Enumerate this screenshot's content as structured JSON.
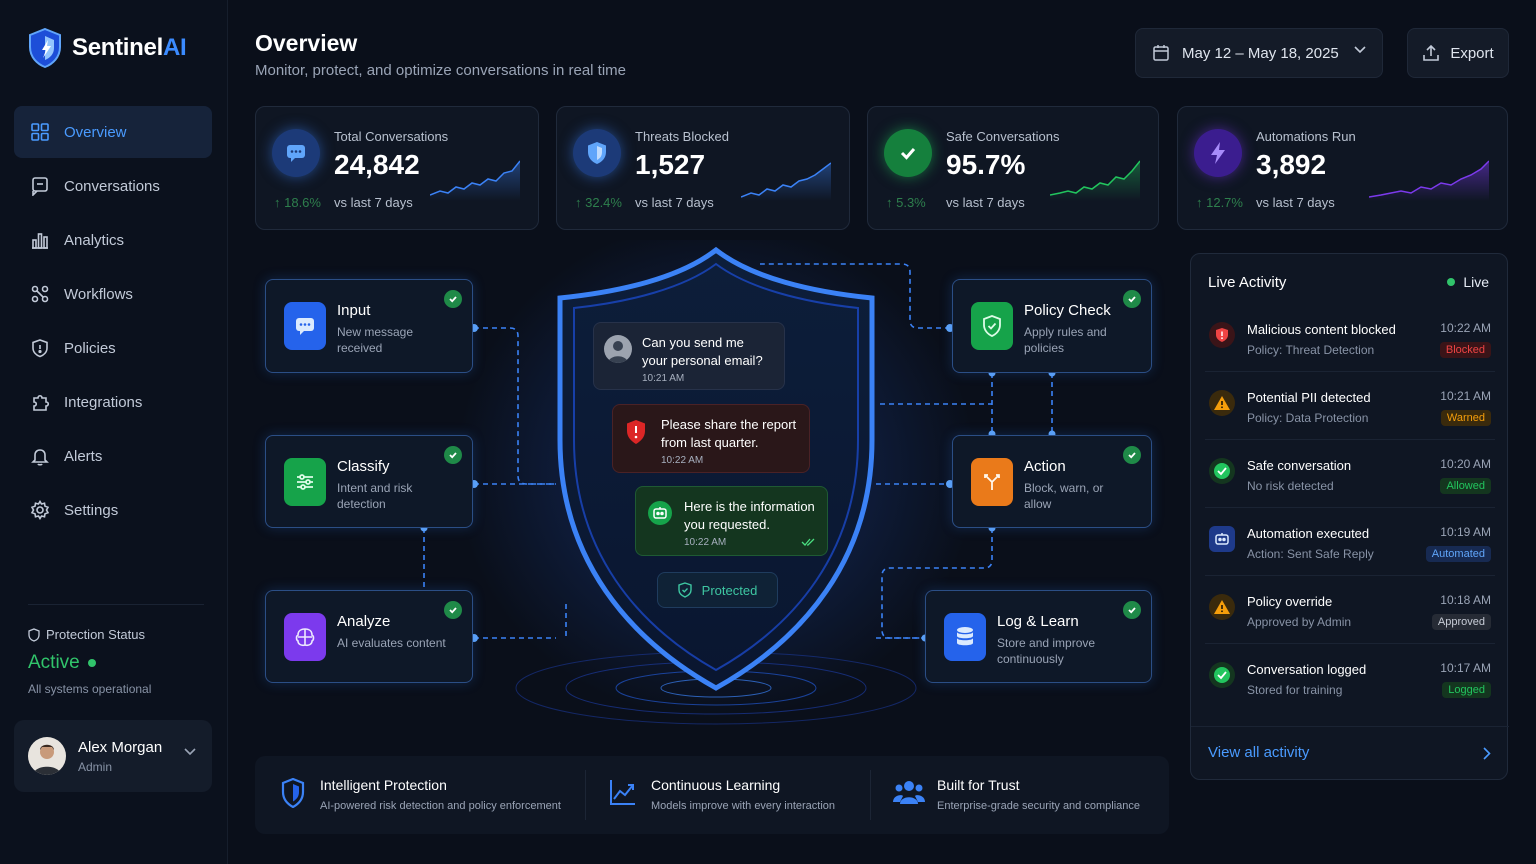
{
  "brand": {
    "name_main": "Sentinel",
    "name_accent": "AI"
  },
  "sidebar": {
    "items": [
      {
        "label": "Overview",
        "icon": "grid-icon",
        "active": true
      },
      {
        "label": "Conversations",
        "icon": "chat-icon"
      },
      {
        "label": "Analytics",
        "icon": "bar-chart-icon"
      },
      {
        "label": "Workflows",
        "icon": "workflow-icon"
      },
      {
        "label": "Policies",
        "icon": "shield-doc-icon"
      },
      {
        "label": "Integrations",
        "icon": "puzzle-icon"
      },
      {
        "label": "Alerts",
        "icon": "bell-icon"
      },
      {
        "label": "Settings",
        "icon": "gear-icon"
      }
    ],
    "protection": {
      "label": "Protection Status",
      "status": "Active",
      "sub": "All systems operational"
    },
    "user": {
      "name": "Alex Morgan",
      "role": "Admin"
    }
  },
  "header": {
    "title": "Overview",
    "subtitle": "Monitor, protect, and optimize conversations in real time",
    "date_range": "May 12 – May 18, 2025",
    "export_label": "Export"
  },
  "stats": [
    {
      "label": "Total Conversations",
      "value": "24,842",
      "delta": "↑ 18.6%",
      "vs": "vs last 7 days",
      "color": "#3b82f6",
      "icon": "chat-bubble-icon"
    },
    {
      "label": "Threats Blocked",
      "value": "1,527",
      "delta": "↑ 32.4%",
      "vs": "vs last 7 days",
      "color": "#3b82f6",
      "icon": "shield-icon"
    },
    {
      "label": "Safe Conversations",
      "value": "95.7%",
      "delta": "↑ 5.3%",
      "vs": "vs last 7 days",
      "color": "#22c55e",
      "icon": "check-icon"
    },
    {
      "label": "Automations Run",
      "value": "3,892",
      "delta": "↑ 12.7%",
      "vs": "vs last 7 days",
      "color": "#7c3aed",
      "icon": "bolt-icon"
    }
  ],
  "flow": {
    "nodes": [
      {
        "title": "Input",
        "desc": "New message received",
        "color": "#2563eb",
        "icon": "chat-bubble-icon"
      },
      {
        "title": "Classify",
        "desc": "Intent and risk detection",
        "color": "#16a34a",
        "icon": "sliders-icon"
      },
      {
        "title": "Analyze",
        "desc": "AI evaluates content",
        "color": "#7c3aed",
        "icon": "brain-icon"
      },
      {
        "title": "Policy Check",
        "desc": "Apply rules and policies",
        "color": "#16a34a",
        "icon": "shield-check-icon"
      },
      {
        "title": "Action",
        "desc": "Block, warn, or allow",
        "color": "#ea7a1a",
        "icon": "branch-icon"
      },
      {
        "title": "Log & Learn",
        "desc": "Store and improve continuously",
        "color": "#2563eb",
        "icon": "database-icon"
      }
    ],
    "messages": [
      {
        "text_line1": "Can you send me",
        "text_line2": "your personal email?",
        "time": "10:21 AM"
      },
      {
        "text_line1": "Please share the report",
        "text_line2": "from last quarter.",
        "time": "10:22 AM"
      },
      {
        "text_line1": "Here is the information",
        "text_line2": "you requested.",
        "time": "10:22 AM"
      }
    ],
    "protected_label": "Protected"
  },
  "live": {
    "title": "Live Activity",
    "badge": "Live",
    "items": [
      {
        "title": "Malicious content blocked",
        "sub": "Policy: Threat Detection",
        "time": "10:22 AM",
        "tag": "Blocked",
        "tag_color": "#ef4444",
        "icon": "shield-alert-icon"
      },
      {
        "title": "Potential PII detected",
        "sub": "Policy: Data Protection",
        "time": "10:21 AM",
        "tag": "Warned",
        "tag_color": "#f59e0b",
        "icon": "warning-icon"
      },
      {
        "title": "Safe conversation",
        "sub": "No risk detected",
        "time": "10:20 AM",
        "tag": "Allowed",
        "tag_color": "#22c55e",
        "icon": "check-icon"
      },
      {
        "title": "Automation executed",
        "sub": "Action: Sent Safe Reply",
        "time": "10:19 AM",
        "tag": "Automated",
        "tag_color": "#3b82f6",
        "icon": "bot-icon"
      },
      {
        "title": "Policy override",
        "sub": "Approved by Admin",
        "time": "10:18 AM",
        "tag": "Approved",
        "tag_color": "#9ca3af",
        "icon": "warning-icon"
      },
      {
        "title": "Conversation logged",
        "sub": "Stored for training",
        "time": "10:17 AM",
        "tag": "Logged",
        "tag_color": "#22c55e",
        "icon": "check-icon"
      }
    ],
    "view_all": "View all activity"
  },
  "features": [
    {
      "title": "Intelligent Protection",
      "desc": "AI-powered risk detection and policy enforcement",
      "icon": "shield-icon"
    },
    {
      "title": "Continuous Learning",
      "desc": "Models improve with every interaction",
      "icon": "trend-icon"
    },
    {
      "title": "Built for Trust",
      "desc": "Enterprise-grade security and compliance",
      "icon": "team-icon"
    }
  ]
}
